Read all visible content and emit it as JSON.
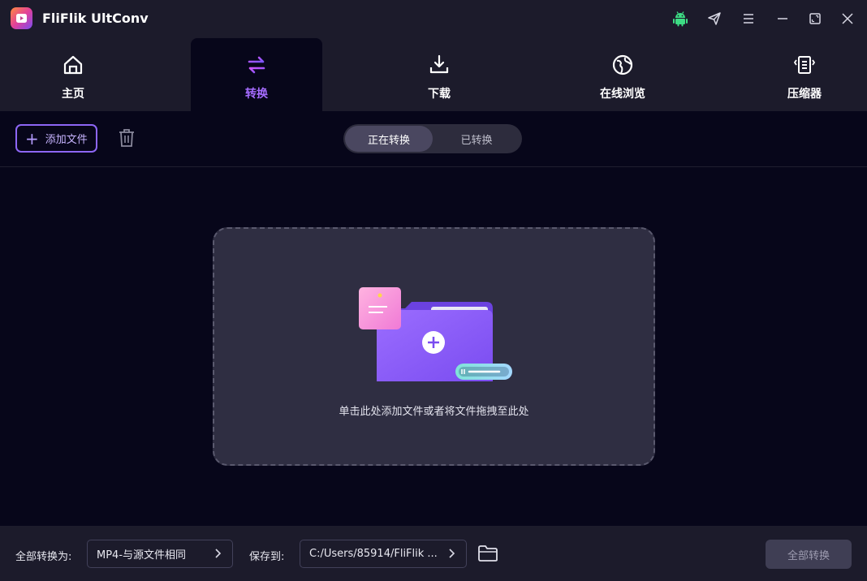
{
  "app": {
    "title": "FliFlik UltConv"
  },
  "nav": {
    "tabs": [
      {
        "label": "主页",
        "icon": "home-icon"
      },
      {
        "label": "转换",
        "icon": "convert-arrows-icon",
        "active": true
      },
      {
        "label": "下载",
        "icon": "download-icon"
      },
      {
        "label": "在线浏览",
        "icon": "globe-icon"
      },
      {
        "label": "压缩器",
        "icon": "compress-icon"
      }
    ]
  },
  "toolbar": {
    "add_label": "添加文件",
    "segments": [
      "正在转换",
      "已转换"
    ],
    "active_segment": "正在转换"
  },
  "dropzone": {
    "text": "单击此处添加文件或者将文件拖拽至此处"
  },
  "bottom": {
    "convert_to_label": "全部转换为:",
    "format_value": "MP4-与源文件相同",
    "save_to_label": "保存到:",
    "save_path": "C:/Users/85914/FliFlik ...",
    "convert_all_label": "全部转换"
  },
  "colors": {
    "accent": "#a56cff",
    "background": "#07061a",
    "panel": "#1c1b2b",
    "dropzone": "#2f2e42"
  }
}
